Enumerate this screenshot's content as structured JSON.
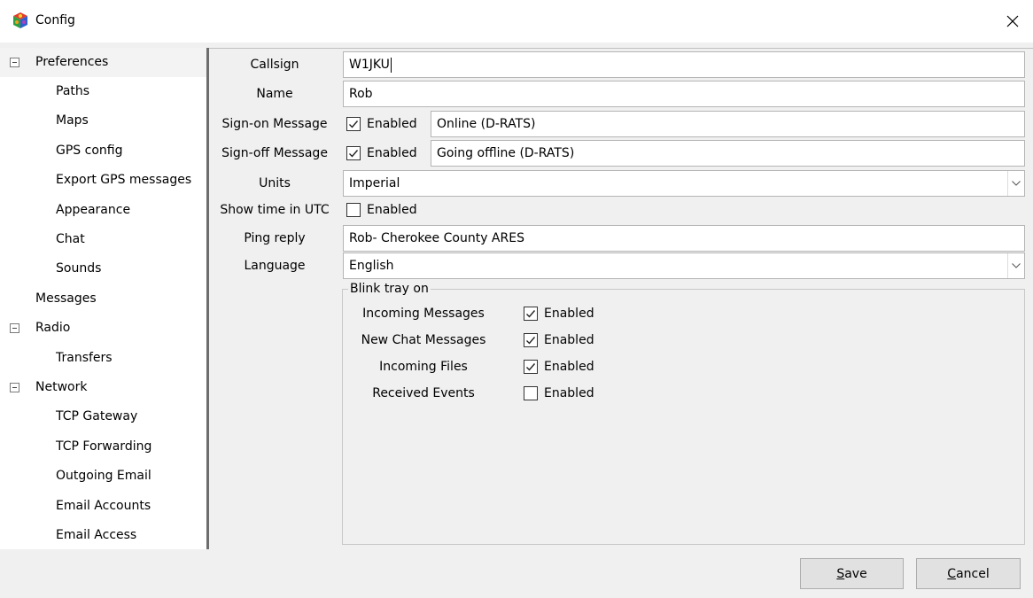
{
  "window": {
    "title": "Config",
    "icon": "colorful-cube-icon",
    "close_glyph": "✕"
  },
  "tree": {
    "items": [
      {
        "label": "Preferences",
        "level": 0,
        "expanded": true
      },
      {
        "label": "Paths",
        "level": 1
      },
      {
        "label": "Maps",
        "level": 1
      },
      {
        "label": "GPS config",
        "level": 1
      },
      {
        "label": "Export GPS messages",
        "level": 1
      },
      {
        "label": "Appearance",
        "level": 1
      },
      {
        "label": "Chat",
        "level": 1
      },
      {
        "label": "Sounds",
        "level": 1
      },
      {
        "label": "Messages",
        "level": 0
      },
      {
        "label": "Radio",
        "level": 0,
        "expanded": true
      },
      {
        "label": "Transfers",
        "level": 1
      },
      {
        "label": "Network",
        "level": 0,
        "expanded": true
      },
      {
        "label": "TCP Gateway",
        "level": 1
      },
      {
        "label": "TCP Forwarding",
        "level": 1
      },
      {
        "label": "Outgoing Email",
        "level": 1
      },
      {
        "label": "Email Accounts",
        "level": 1
      },
      {
        "label": "Email Access",
        "level": 1
      }
    ]
  },
  "form": {
    "callsign": {
      "label": "Callsign",
      "value": "W1JKU"
    },
    "name": {
      "label": "Name",
      "value": "Rob"
    },
    "signon": {
      "label": "Sign-on Message",
      "checkbox_label": "Enabled",
      "checked": true,
      "value": "Online (D-RATS)"
    },
    "signoff": {
      "label": "Sign-off Message",
      "checkbox_label": "Enabled",
      "checked": true,
      "value": "Going offline (D-RATS)"
    },
    "units": {
      "label": "Units",
      "value": "Imperial"
    },
    "utc": {
      "label": "Show time in UTC",
      "checkbox_label": "Enabled",
      "checked": false
    },
    "ping": {
      "label": "Ping reply",
      "value": "Rob- Cherokee County ARES"
    },
    "language": {
      "label": "Language",
      "value": "English"
    },
    "blink": {
      "legend": "Blink tray on",
      "rows": [
        {
          "label": "Incoming Messages",
          "checkbox_label": "Enabled",
          "checked": true
        },
        {
          "label": "New Chat Messages",
          "checkbox_label": "Enabled",
          "checked": true
        },
        {
          "label": "Incoming Files",
          "checkbox_label": "Enabled",
          "checked": true
        },
        {
          "label": "Received Events",
          "checkbox_label": "Enabled",
          "checked": false
        }
      ]
    }
  },
  "buttons": {
    "save": {
      "mnemonic": "S",
      "rest": "ave"
    },
    "cancel": {
      "mnemonic": "C",
      "rest": "ancel"
    }
  },
  "glyphs": {
    "check": "✓",
    "arrow": "⌵"
  }
}
